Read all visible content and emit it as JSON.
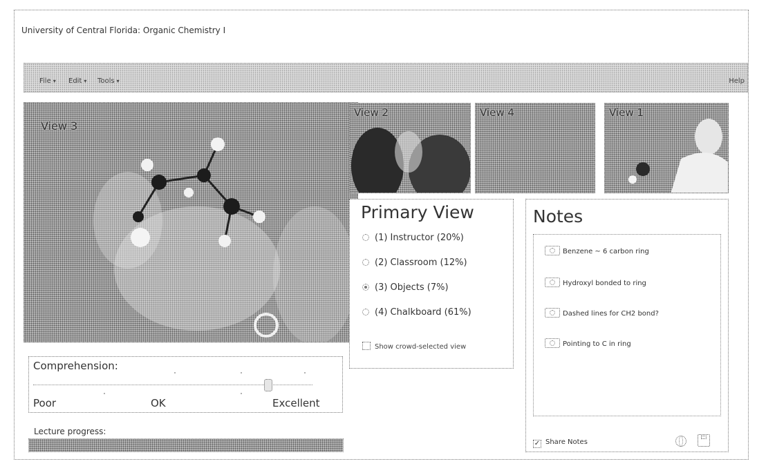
{
  "app": {
    "title": "University of Central Florida: Organic Chemistry I"
  },
  "menu": {
    "items": [
      {
        "label": "File"
      },
      {
        "label": "Edit"
      },
      {
        "label": "Tools"
      }
    ],
    "help_label": "Help"
  },
  "views": {
    "main": {
      "label": "View 3"
    },
    "thumbs": [
      {
        "label": "View 2"
      },
      {
        "label": "View 4"
      },
      {
        "label": "View 1"
      }
    ]
  },
  "comprehension": {
    "title": "Comprehension:",
    "scale_labels": [
      "Poor",
      "OK",
      "Excellent"
    ],
    "value_fraction": 0.84
  },
  "progress": {
    "label": "Lecture progress:",
    "value_fraction": 1.0
  },
  "primary_view": {
    "title": "Primary View",
    "options": [
      {
        "label": "(1) Instructor (20%)",
        "selected": false
      },
      {
        "label": "(2) Classroom (12%)",
        "selected": false
      },
      {
        "label": "(3) Objects (7%)",
        "selected": true
      },
      {
        "label": "(4) Chalkboard (61%)",
        "selected": false
      }
    ],
    "crowd_label": "Show crowd-selected view"
  },
  "notes": {
    "title": "Notes",
    "items": [
      {
        "text": "Benzene ~ 6 carbon ring"
      },
      {
        "text": "Hydroxyl bonded to ring"
      },
      {
        "text": "Dashed lines for CH2 bond?"
      },
      {
        "text": "Pointing to C in ring"
      }
    ],
    "share_label": "Share Notes",
    "share_checked": true
  },
  "icons": {
    "note": "camera-icon",
    "globe": "globe-icon",
    "save": "save-icon",
    "menu_caret": "chevron-down-icon"
  }
}
